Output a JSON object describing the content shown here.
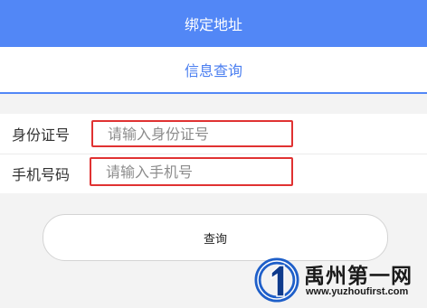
{
  "header": {
    "title": "绑定地址"
  },
  "tabs": [
    {
      "label": "信息查询",
      "active": true
    }
  ],
  "form": {
    "id_card": {
      "label": "身份证号",
      "placeholder": "请输入身份证号",
      "value": ""
    },
    "phone": {
      "label": "手机号码",
      "placeholder": "请输入手机号",
      "value": ""
    }
  },
  "actions": {
    "query_label": "查询"
  },
  "watermark": {
    "title": "禹州第一网",
    "url": "www.yuzhoufirst.com"
  },
  "colors": {
    "accent": "#5287f6",
    "tab_text": "#4a7ef0",
    "highlight_border": "#e03232",
    "background": "#f3f3f3"
  },
  "icons": {
    "watermark_logo": "blue-number-one-logo-icon"
  }
}
